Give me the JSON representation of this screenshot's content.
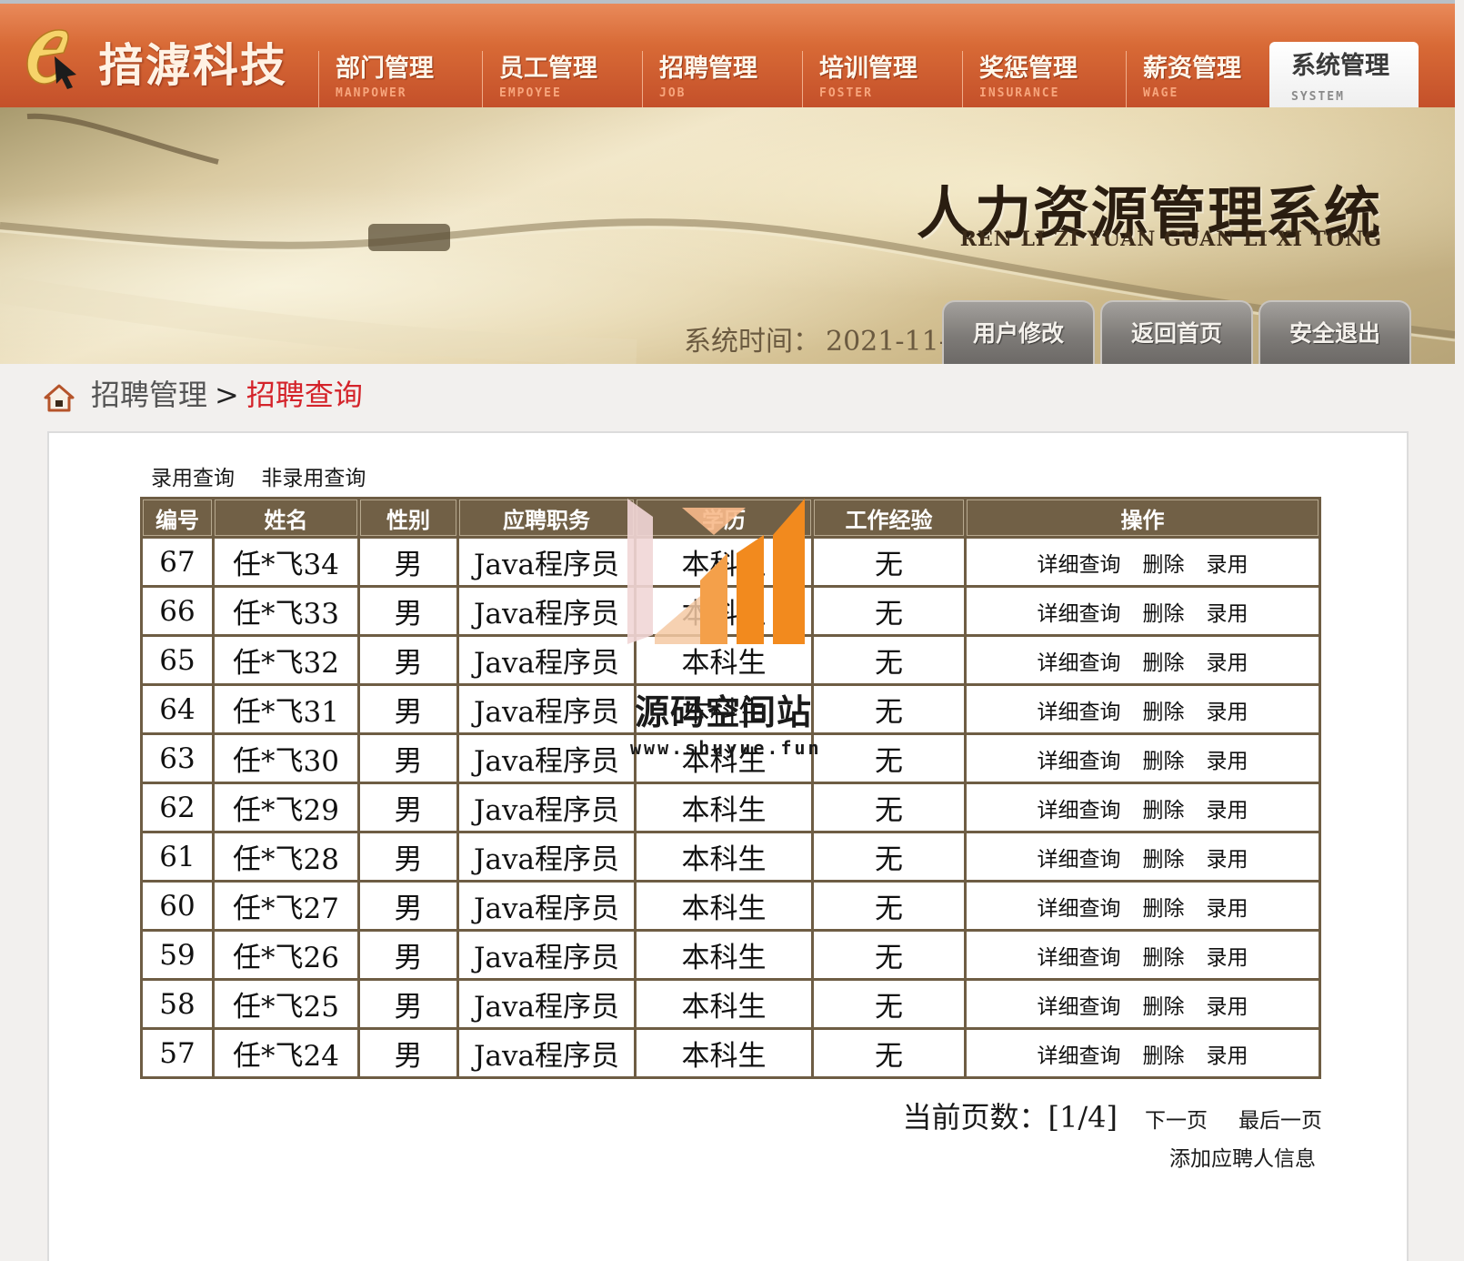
{
  "brand": {
    "name": "揞滹科技",
    "logo_icon": "e-cursor-logo-icon"
  },
  "nav": [
    {
      "cn": "部门管理",
      "en": "MANPOWER",
      "active": false
    },
    {
      "cn": "员工管理",
      "en": "EMPOYEE",
      "active": false
    },
    {
      "cn": "招聘管理",
      "en": "JOB",
      "active": false
    },
    {
      "cn": "培训管理",
      "en": "FOSTER",
      "active": false
    },
    {
      "cn": "奖惩管理",
      "en": "INSURANCE",
      "active": false
    },
    {
      "cn": "薪资管理",
      "en": "WAGE",
      "active": false
    },
    {
      "cn": "系统管理",
      "en": "SYSTEM",
      "active": true
    }
  ],
  "banner": {
    "title": "人力资源管理系统",
    "subtitle": "REN LI ZI YUAN GUAN LI XI TONG",
    "systime_label": "系统时间：",
    "systime_value": "2021-11-6"
  },
  "top_buttons": {
    "modify_user": "用户修改",
    "home": "返回首页",
    "logout": "安全退出"
  },
  "breadcrumb": {
    "parent": "招聘管理",
    "separator": ">",
    "current": "招聘查询"
  },
  "filters": {
    "hired": "录用查询",
    "not_hired": "非录用查询"
  },
  "table": {
    "headers": [
      "编号",
      "姓名",
      "性别",
      "应聘职务",
      "学历",
      "工作经验",
      "操作"
    ],
    "ops": {
      "detail": "详细查询",
      "delete": "删除",
      "hire": "录用"
    },
    "rows": [
      {
        "id": "67",
        "name": "任*飞34",
        "gender": "男",
        "job": "Java程序员",
        "edu": "本科生",
        "exp": "无"
      },
      {
        "id": "66",
        "name": "任*飞33",
        "gender": "男",
        "job": "Java程序员",
        "edu": "本科生",
        "exp": "无"
      },
      {
        "id": "65",
        "name": "任*飞32",
        "gender": "男",
        "job": "Java程序员",
        "edu": "本科生",
        "exp": "无"
      },
      {
        "id": "64",
        "name": "任*飞31",
        "gender": "男",
        "job": "Java程序员",
        "edu": "本科生",
        "exp": "无"
      },
      {
        "id": "63",
        "name": "任*飞30",
        "gender": "男",
        "job": "Java程序员",
        "edu": "本科生",
        "exp": "无"
      },
      {
        "id": "62",
        "name": "任*飞29",
        "gender": "男",
        "job": "Java程序员",
        "edu": "本科生",
        "exp": "无"
      },
      {
        "id": "61",
        "name": "任*飞28",
        "gender": "男",
        "job": "Java程序员",
        "edu": "本科生",
        "exp": "无"
      },
      {
        "id": "60",
        "name": "任*飞27",
        "gender": "男",
        "job": "Java程序员",
        "edu": "本科生",
        "exp": "无"
      },
      {
        "id": "59",
        "name": "任*飞26",
        "gender": "男",
        "job": "Java程序员",
        "edu": "本科生",
        "exp": "无"
      },
      {
        "id": "58",
        "name": "任*飞25",
        "gender": "男",
        "job": "Java程序员",
        "edu": "本科生",
        "exp": "无"
      },
      {
        "id": "57",
        "name": "任*飞24",
        "gender": "男",
        "job": "Java程序员",
        "edu": "本科生",
        "exp": "无"
      }
    ]
  },
  "pager": {
    "label": "当前页数：",
    "value": "[1/4]",
    "next": "下一页",
    "last": "最后一页"
  },
  "add_link": "添加应聘人信息",
  "watermark": {
    "name": "源码空间站",
    "url": "www.shuyue.fun"
  },
  "colors": {
    "nav_orange": "#d86a36",
    "header_brown": "#716046",
    "breadcrumb_red": "#d4232a",
    "button_gray": "#7e7b78",
    "watermark_orange": "#f28a1e"
  }
}
